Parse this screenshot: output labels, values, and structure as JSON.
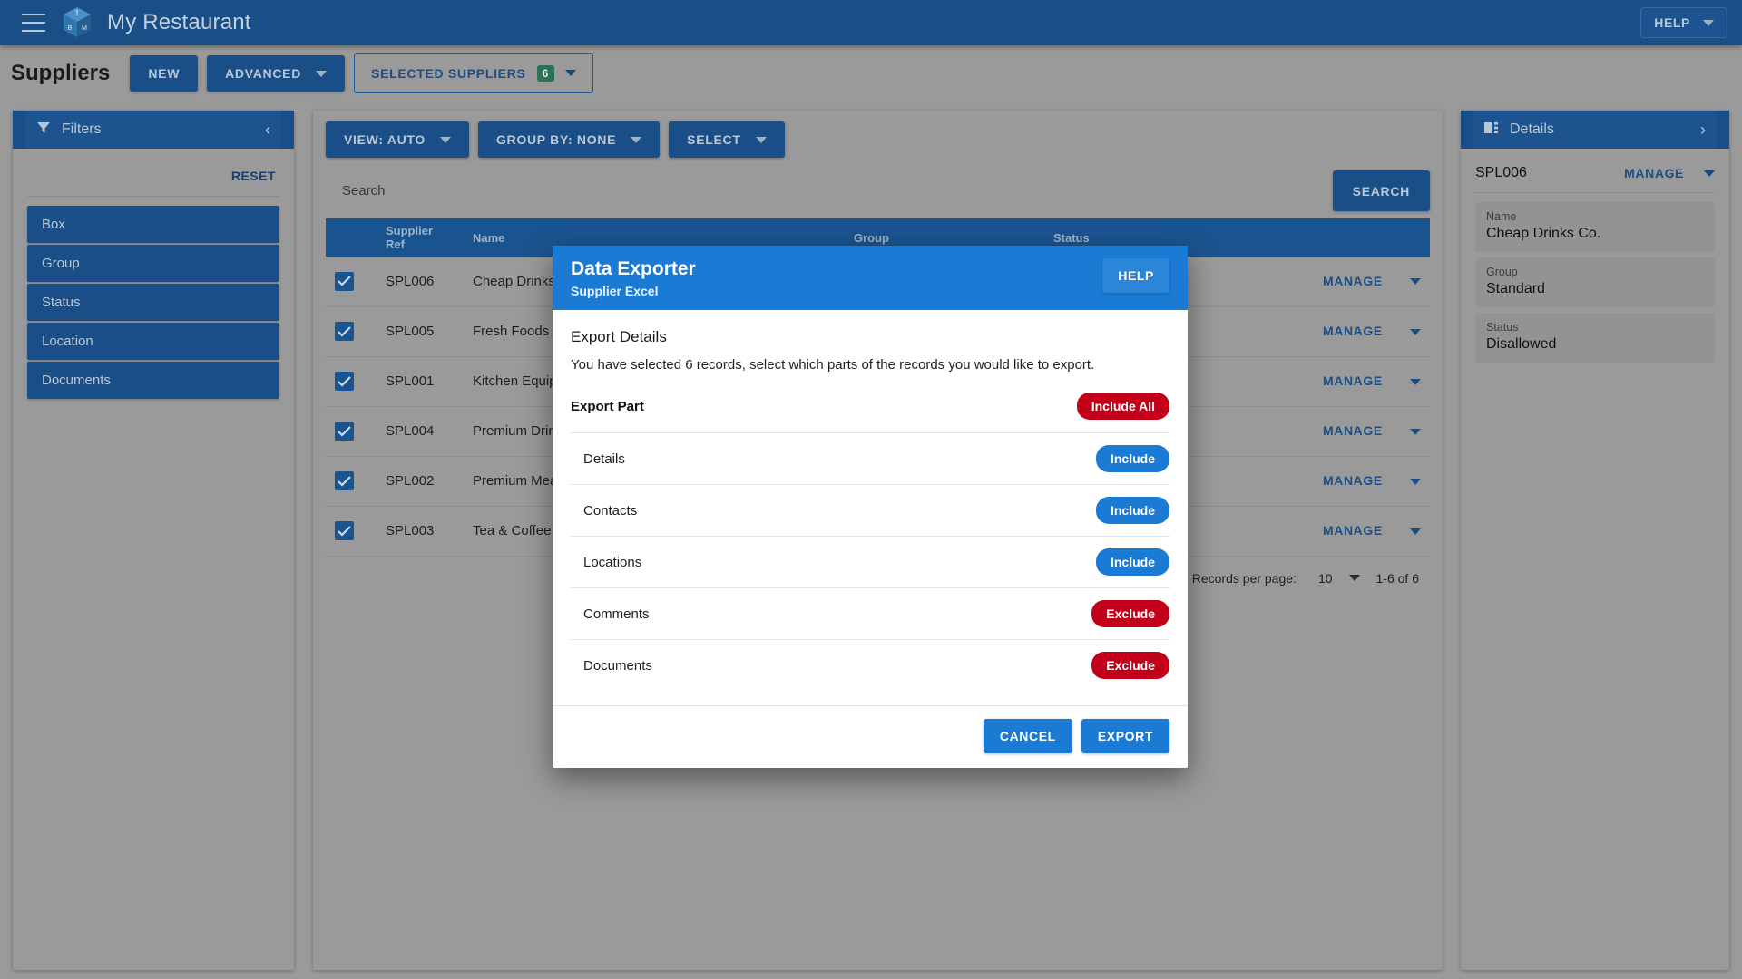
{
  "appbar": {
    "menu_icon": "hamburger-icon",
    "logo_icon": "cube-logo-icon",
    "logo_letters": {
      "top": "1",
      "left": "B",
      "right": "M"
    },
    "title": "My Restaurant",
    "help_label": "HELP"
  },
  "pagehead": {
    "title": "Suppliers",
    "new_label": "NEW",
    "advanced_label": "ADVANCED",
    "selected_label": "SELECTED SUPPLIERS",
    "selected_count": "6"
  },
  "filters": {
    "icon": "funnel-icon",
    "title": "Filters",
    "collapse_icon": "chevron-left-icon",
    "reset_label": "RESET",
    "items": [
      {
        "label": "Box"
      },
      {
        "label": "Group"
      },
      {
        "label": "Status"
      },
      {
        "label": "Location"
      },
      {
        "label": "Documents"
      }
    ]
  },
  "toolbar": {
    "view_label": "VIEW: AUTO",
    "group_by_label": "GROUP BY: NONE",
    "select_label": "SELECT"
  },
  "search": {
    "value": "",
    "placeholder": "Search",
    "button_label": "SEARCH"
  },
  "table": {
    "columns": [
      "",
      "Supplier Ref",
      "Name",
      "Group",
      "Status",
      ""
    ],
    "row_action_label": "MANAGE",
    "rows": [
      {
        "checked": true,
        "ref": "SPL006",
        "name": "Cheap Drinks Co.",
        "group": "",
        "status": ""
      },
      {
        "checked": true,
        "ref": "SPL005",
        "name": "Fresh Foods",
        "group": "",
        "status": ""
      },
      {
        "checked": true,
        "ref": "SPL001",
        "name": "Kitchen Equipment",
        "group": "",
        "status": ""
      },
      {
        "checked": true,
        "ref": "SPL004",
        "name": "Premium Drinks",
        "group": "",
        "status": ""
      },
      {
        "checked": true,
        "ref": "SPL002",
        "name": "Premium Meats",
        "group": "",
        "status": ""
      },
      {
        "checked": true,
        "ref": "SPL003",
        "name": "Tea & Coffee",
        "group": "",
        "status": ""
      }
    ]
  },
  "pager": {
    "records_per_page_label": "Records per page:",
    "records_per_page_value": "10",
    "range_label": "1-6 of 6"
  },
  "details": {
    "icon": "details-panel-icon",
    "title": "Details",
    "expand_icon": "chevron-right-icon",
    "record_ref": "SPL006",
    "manage_label": "MANAGE",
    "fields": [
      {
        "label": "Name",
        "value": "Cheap Drinks Co."
      },
      {
        "label": "Group",
        "value": "Standard"
      },
      {
        "label": "Status",
        "value": "Disallowed"
      }
    ]
  },
  "modal": {
    "title": "Data Exporter",
    "subtitle": "Supplier Excel",
    "help_label": "HELP",
    "section_title": "Export Details",
    "section_desc": "You have selected 6 records, select which parts of the records you would like to export.",
    "export_part_label": "Export Part",
    "include_all_label": "Include All",
    "parts": [
      {
        "name": "Details",
        "state": "Include",
        "state_kind": "include"
      },
      {
        "name": "Contacts",
        "state": "Include",
        "state_kind": "include"
      },
      {
        "name": "Locations",
        "state": "Include",
        "state_kind": "include"
      },
      {
        "name": "Comments",
        "state": "Exclude",
        "state_kind": "exclude"
      },
      {
        "name": "Documents",
        "state": "Exclude",
        "state_kind": "exclude"
      }
    ],
    "cancel_label": "CANCEL",
    "export_label": "EXPORT"
  },
  "colors": {
    "appbar_blue": "#1a4e86",
    "modal_blue": "#1b7ad4",
    "include_blue": "#1b7ad4",
    "exclude_red": "#c3001a",
    "badge_green": "#2b7257",
    "page_grey": "#9a9a9a"
  }
}
